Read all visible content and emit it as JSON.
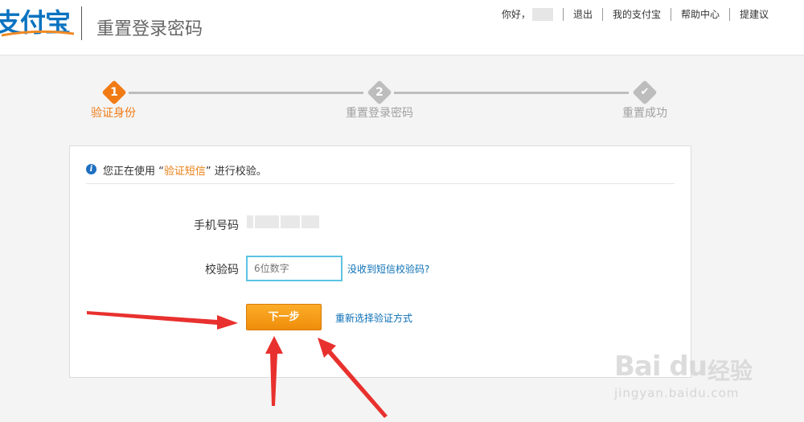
{
  "header": {
    "logo_text": "支付宝",
    "title": "重置登录密码",
    "nav": {
      "greeting": "你好，",
      "logout": "退出",
      "my_alipay": "我的支付宝",
      "help_center": "帮助中心",
      "feedback": "提建议"
    }
  },
  "colors": {
    "active": "#f07b14",
    "inactive": "#bdbdbd",
    "link": "#0a6fb6",
    "input_border": "#5cc3e3"
  },
  "steps": [
    {
      "num": "1",
      "label": "验证身份",
      "state": "active"
    },
    {
      "num": "2",
      "label": "重置登录密码",
      "state": "pending"
    },
    {
      "num": "✔",
      "label": "重置成功",
      "state": "pending"
    }
  ],
  "form": {
    "notice_prefix": "您正在使用 “",
    "notice_method": "验证短信",
    "notice_suffix": "” 进行校验。",
    "phone_label": "手机号码",
    "code_label": "校验码",
    "code_placeholder": "6位数字",
    "no_sms_link": "没收到短信校验码?",
    "next_button": "下一步",
    "reselect_link": "重新选择验证方式"
  },
  "watermark": {
    "brand": "Bai du",
    "jingyan": "经验",
    "url": "jingyan.baidu.com"
  }
}
